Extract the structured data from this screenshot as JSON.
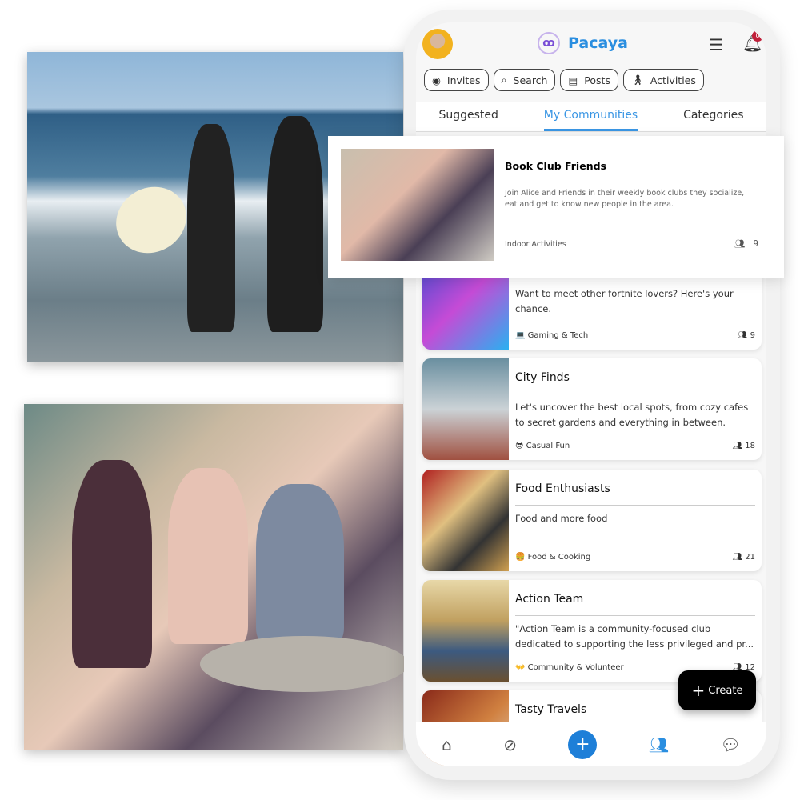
{
  "app": {
    "name": "Pacaya",
    "notification_count": "0"
  },
  "header": {
    "chips": [
      {
        "label": "Invites",
        "icon": "bell-circle-icon"
      },
      {
        "label": "Search",
        "icon": "search-icon"
      },
      {
        "label": "Posts",
        "icon": "newspaper-icon"
      },
      {
        "label": "Activities",
        "icon": "hiker-icon"
      }
    ]
  },
  "tabs": [
    {
      "label": "Suggested"
    },
    {
      "label": "My Communities",
      "active": true
    },
    {
      "label": "Categories"
    }
  ],
  "featured": {
    "title": "Book Club Friends",
    "description": "Join Alice and Friends in their weekly book clubs they socialize, eat and get to know new people in the area.",
    "category": "Indoor Activities",
    "members": "9"
  },
  "communities": [
    {
      "title": "",
      "description": "Want to meet other  fortnite lovers? Here's your chance.",
      "category": "💻 Gaming & Tech",
      "members": "9"
    },
    {
      "title": "City Finds",
      "description": "Let's uncover the best local spots, from cozy cafes to secret gardens and everything in between.",
      "category": "😎 Casual Fun",
      "members": "18"
    },
    {
      "title": "Food Enthusiasts",
      "description": "Food and more food",
      "category": "🍔 Food & Cooking",
      "members": "21"
    },
    {
      "title": "Action Team",
      "description": "\"Action Team is a community-focused club dedicated to supporting the less privileged and pr...",
      "category": "👐 Community & Volunteer",
      "members": "12"
    },
    {
      "title": "Tasty Travels",
      "description": "",
      "category": "",
      "members": ""
    }
  ],
  "fab": {
    "label": "Create"
  },
  "nav": [
    "home-icon",
    "compass-icon",
    "plus-icon",
    "community-icon",
    "chat-icon"
  ],
  "colors": {
    "accent": "#2a8ee0",
    "fab": "#000000",
    "badge": "#c0203a",
    "nav_plus": "#1e7fd8"
  }
}
